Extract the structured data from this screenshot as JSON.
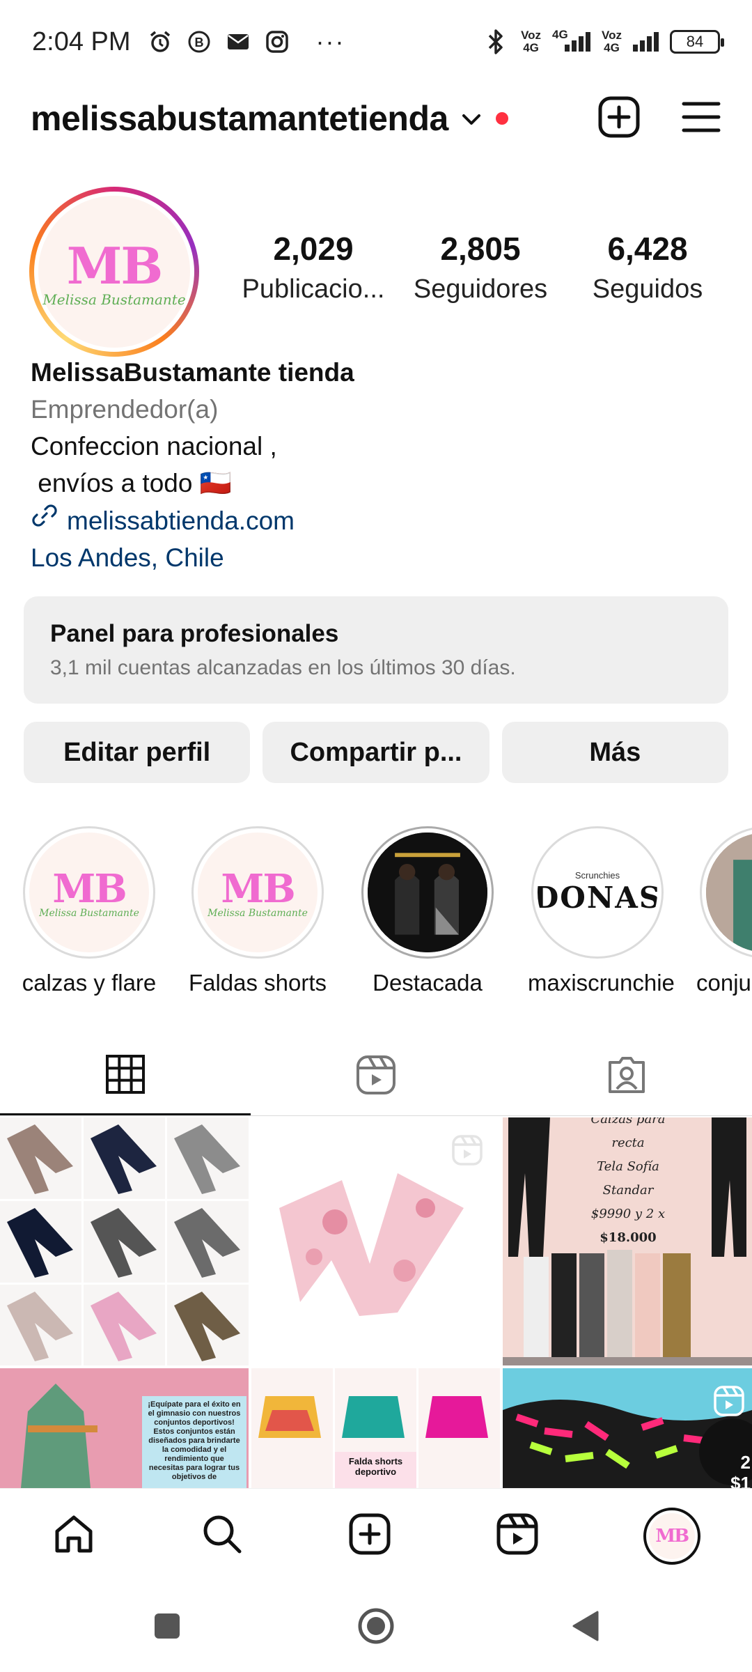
{
  "status_bar": {
    "time": "2:04 PM",
    "net1": "Voz\n4G",
    "net2": "4G",
    "net3": "Voz\n4G",
    "battery": "84",
    "more": "···"
  },
  "header": {
    "username": "melissabustamantetienda"
  },
  "profile": {
    "avatar_text": "MB",
    "avatar_script": "Melissa Bustamante",
    "stats": [
      {
        "num": "2,029",
        "label": "Publicacio..."
      },
      {
        "num": "2,805",
        "label": "Seguidores"
      },
      {
        "num": "6,428",
        "label": "Seguidos"
      }
    ],
    "name": "MelissaBustamante tienda",
    "category": "Emprendedor(a)",
    "bio_line1": "Confeccion nacional ,",
    "bio_line2": " envíos a todo 🇨🇱",
    "link": "melissabtienda.com",
    "location": "Los Andes, Chile"
  },
  "pro_panel": {
    "title": "Panel para profesionales",
    "subtitle": "3,1 mil cuentas alcanzadas en los últimos 30 días."
  },
  "buttons": {
    "edit": "Editar perfil",
    "share": "Compartir p...",
    "more": "Más"
  },
  "highlights": [
    {
      "label": "calzas y flare",
      "kind": "logo"
    },
    {
      "label": "Faldas shorts",
      "kind": "logo"
    },
    {
      "label": "Destacada",
      "kind": "photo"
    },
    {
      "label": "maxiscrunchie",
      "kind": "donas"
    },
    {
      "label": "conju",
      "kind": "photo2"
    }
  ],
  "highlight_extra": {
    "scrunchies": "Scrunchies",
    "donas": "DONAS"
  },
  "grid_text": {
    "post3_line1": "Calzas para recta",
    "post3_line2": "Tela Sofía",
    "post3_line3": "Standar",
    "post3_line4": "$9990 y 2 x",
    "post3_line5": "$18.000",
    "post4_text": "¡Equípate para el éxito en el gimnasio con nuestros conjuntos deportivos! Estos conjuntos están diseñados para brindarte la comodidad y el rendimiento que necesitas para lograr tus objetivos de",
    "post5_label": "Falda shorts deportivo",
    "post6_text": "2\n$1"
  },
  "colors": {
    "link": "#00376b",
    "secondary": "#737373",
    "button_bg": "#efefef",
    "notification": "#ff3040",
    "logo_pink": "#f06bd0",
    "logo_green": "#5fae55"
  }
}
